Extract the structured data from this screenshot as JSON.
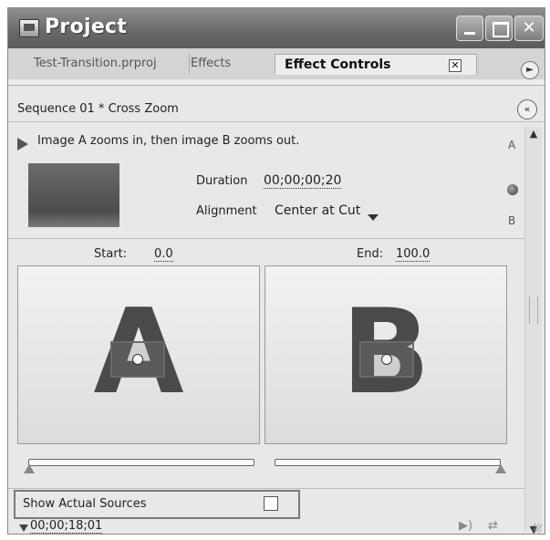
{
  "window": {
    "title": "Project",
    "close_label": "✕"
  },
  "tabs": [
    {
      "label": "Test-Transition.prproj"
    },
    {
      "label": "Effects"
    },
    {
      "label": "Effect Controls",
      "active": true
    }
  ],
  "tab_close_glyph": "✕",
  "flyout_glyph": "►",
  "sequence": {
    "label": "Sequence 01 * Cross Zoom",
    "collapse_glyph": "«"
  },
  "effect": {
    "description": "Image A zooms in, then image B zooms out.",
    "duration_label": "Duration",
    "duration_value": "00;00;00;20",
    "alignment_label": "Alignment",
    "alignment_value": "Center at Cut",
    "a_label": "A",
    "b_label": "B"
  },
  "range": {
    "start_label": "Start:",
    "start_value": "0.0",
    "end_label": "End:",
    "end_value": "100.0"
  },
  "previews": {
    "a_letter": "A",
    "b_letter": "B"
  },
  "sliders": {
    "start_position": 0.0,
    "end_position": 1.0
  },
  "bottom": {
    "show_sources_label": "Show Actual Sources",
    "show_sources_checked": false,
    "timecode": "00;00;18;01",
    "play_only_glyph": "▶)",
    "loop_glyph": "⇄"
  },
  "scrollbar": {
    "up_glyph": "▲",
    "down_glyph": "▼"
  },
  "icons": {
    "app": "project-window-icon",
    "reverse": "reverse-icon",
    "play": "play-transition-icon"
  }
}
